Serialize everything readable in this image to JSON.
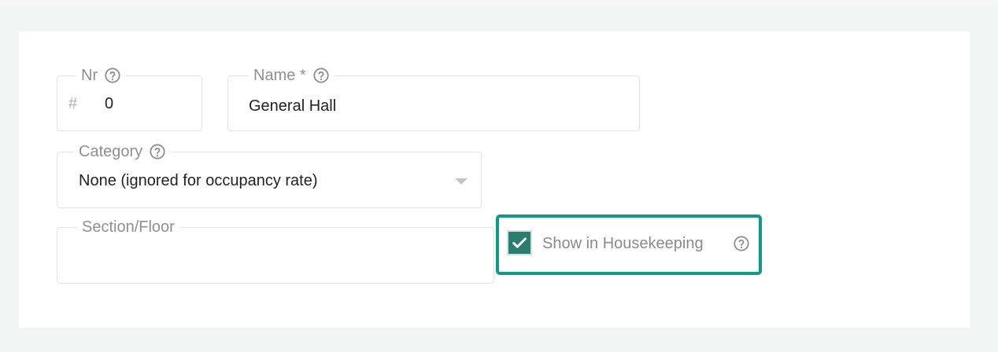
{
  "form": {
    "nr": {
      "label": "Nr",
      "prefix": "#",
      "value": "0"
    },
    "name": {
      "label": "Name *",
      "value": "General Hall"
    },
    "category": {
      "label": "Category",
      "selected": "None (ignored for occupancy rate)"
    },
    "section": {
      "label": "Section/Floor",
      "value": ""
    },
    "housekeeping": {
      "label": "Show in Housekeeping",
      "checked": true
    }
  },
  "icons": {
    "help": "help-circle-icon",
    "dropdown": "caret-down-icon",
    "check": "check-icon"
  },
  "colors": {
    "highlight_border": "#0f9a8a",
    "checkbox_fill": "#2a7d6f"
  }
}
